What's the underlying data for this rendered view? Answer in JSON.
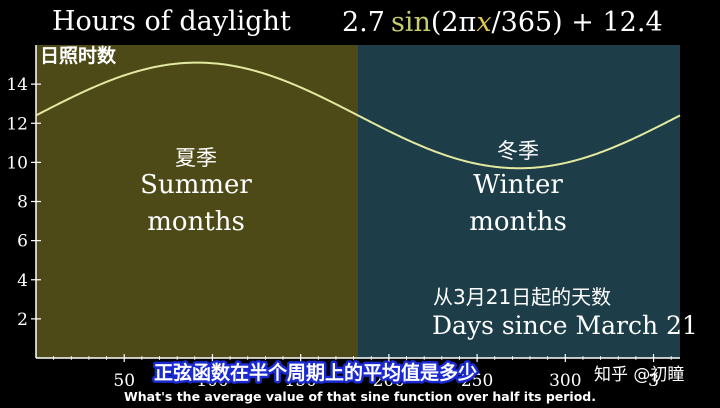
{
  "chart_data": {
    "type": "line",
    "title": "Hours of daylight",
    "title_cn": "日照时数",
    "formula": "2.7 sin(2πx/365) + 12.4",
    "formula_parts": {
      "coef": "2.7",
      "fn": "sin",
      "open": "(2π",
      "var": "x",
      "rest": "/365) + 12.4"
    },
    "xlabel": "Days since March 21",
    "xlabel_cn": "从3月21日起的天数",
    "xlim": [
      0,
      365
    ],
    "ylim": [
      0,
      16
    ],
    "x_ticks": [
      50,
      100,
      150,
      200,
      250,
      300,
      350
    ],
    "x_tick_labels": [
      "50",
      "100",
      "150",
      "200",
      "250",
      "300",
      "3"
    ],
    "y_ticks": [
      2,
      4,
      6,
      8,
      10,
      12,
      14
    ],
    "grid": false,
    "function": {
      "amplitude": 2.7,
      "period": 365,
      "offset": 12.4
    },
    "regions": [
      {
        "label_cn": "夏季",
        "label": [
          "Summer",
          "months"
        ],
        "x_start": 0,
        "x_end": 182.5,
        "color": "#4d4a18"
      },
      {
        "label_cn": "冬季",
        "label": [
          "Winter",
          "months"
        ],
        "x_start": 182.5,
        "x_end": 365,
        "color": "#1d3d48"
      }
    ],
    "curve_color": "#e4e9a0",
    "axis_color": "#ffffff"
  },
  "subtitles": {
    "cn": "正弦函数在半个周期上的平均值是多少",
    "en": "What's the average value of that sine function over half its period."
  },
  "watermark": "知乎 @初瞳"
}
